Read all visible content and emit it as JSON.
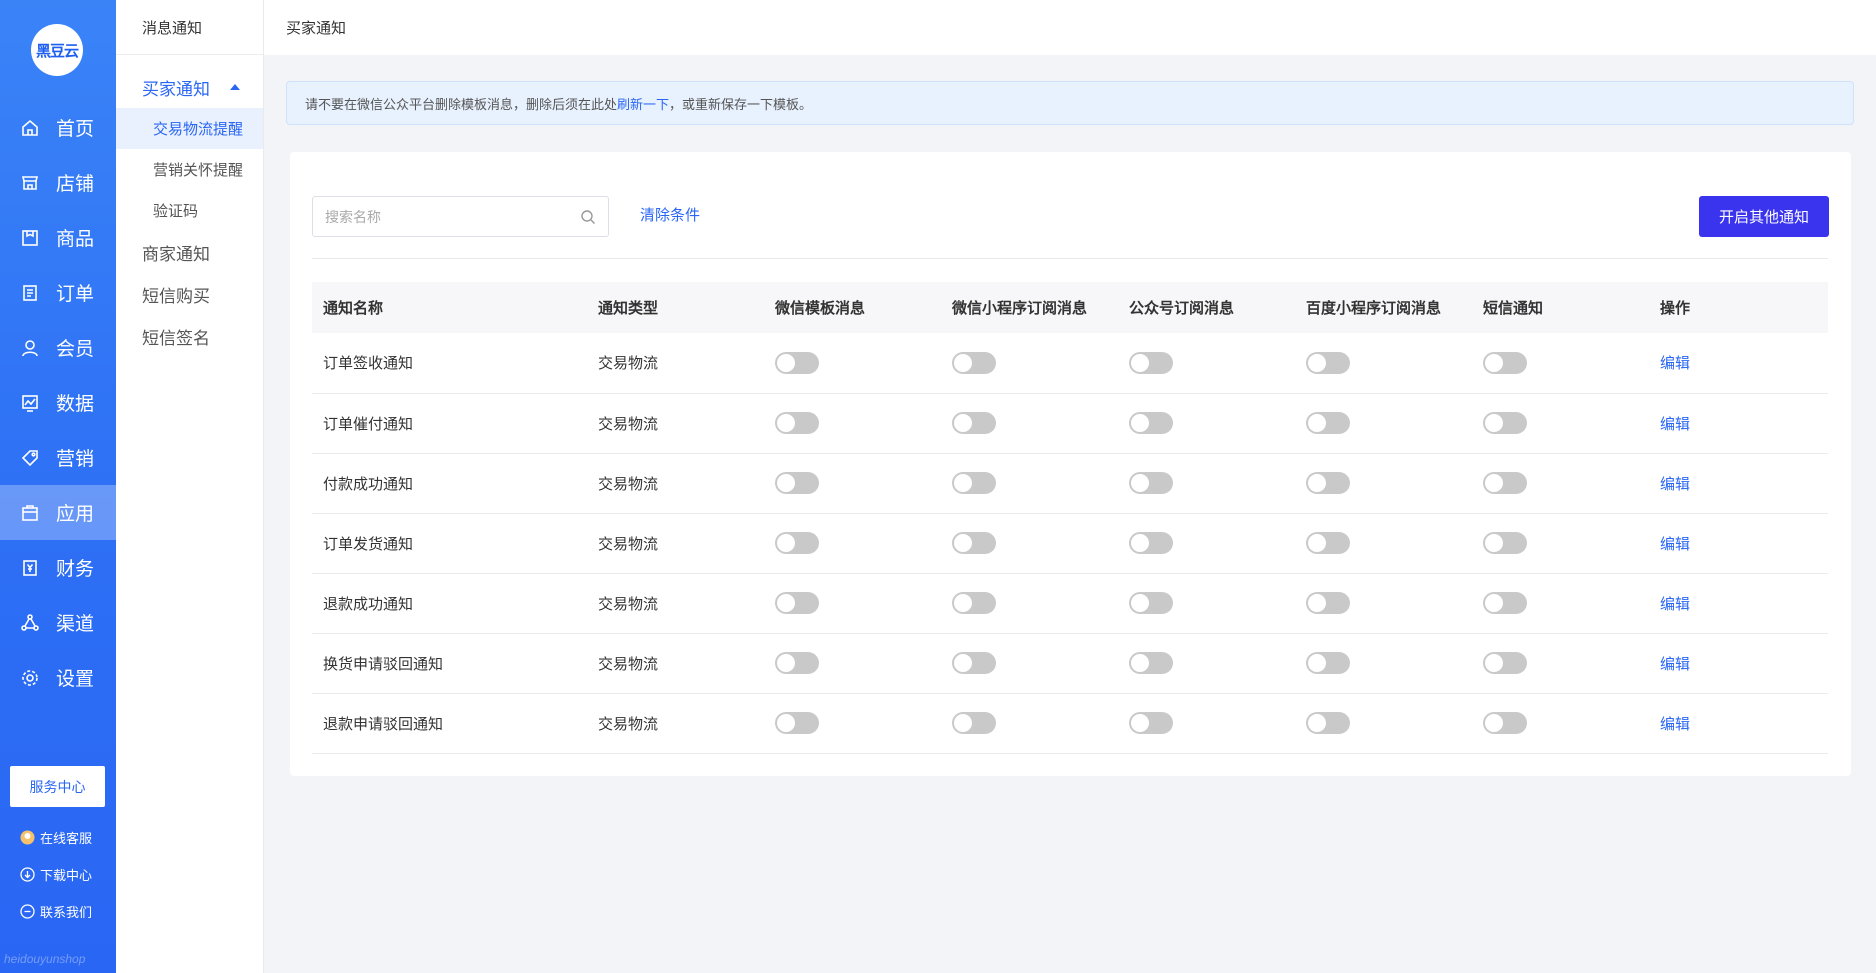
{
  "logo_text": "黑豆云",
  "nav": [
    {
      "label": "首页",
      "icon": "home-icon"
    },
    {
      "label": "店铺",
      "icon": "store-icon"
    },
    {
      "label": "商品",
      "icon": "goods-icon"
    },
    {
      "label": "订单",
      "icon": "order-icon"
    },
    {
      "label": "会员",
      "icon": "member-icon"
    },
    {
      "label": "数据",
      "icon": "chart-icon"
    },
    {
      "label": "营销",
      "icon": "tag-icon"
    },
    {
      "label": "应用",
      "icon": "app-icon",
      "active": true
    },
    {
      "label": "财务",
      "icon": "finance-icon"
    },
    {
      "label": "渠道",
      "icon": "channel-icon"
    },
    {
      "label": "设置",
      "icon": "gear-icon"
    }
  ],
  "service_center": "服务中心",
  "side_links": {
    "online_service": "在线客服",
    "download_center": "下载中心",
    "contact_us": "联系我们"
  },
  "watermark": "heidouyunshop",
  "submenu": {
    "header": "消息通知",
    "buyer_group": "买家通知",
    "buyer_items": [
      "交易物流提醒",
      "营销关怀提醒",
      "验证码"
    ],
    "merchant": "商家通知",
    "sms_buy": "短信购买",
    "sms_sign": "短信签名"
  },
  "topbar_title": "买家通知",
  "notice": {
    "prefix": "请不要在微信公众平台删除模板消息，删除后须在此处 ",
    "link": "刷新一下",
    "suffix": "，或重新保存一下模板。"
  },
  "search": {
    "placeholder": "搜索名称"
  },
  "clear_label": "清除条件",
  "enable_other_label": "开启其他通知",
  "table": {
    "headers": [
      "通知名称",
      "通知类型",
      "微信模板消息",
      "微信小程序订阅消息",
      "公众号订阅消息",
      "百度小程序订阅消息",
      "短信通知",
      "操作"
    ],
    "rows": [
      {
        "name": "订单签收通知",
        "type": "交易物流"
      },
      {
        "name": "订单催付通知",
        "type": "交易物流"
      },
      {
        "name": "付款成功通知",
        "type": "交易物流"
      },
      {
        "name": "订单发货通知",
        "type": "交易物流"
      },
      {
        "name": "退款成功通知",
        "type": "交易物流"
      },
      {
        "name": "换货申请驳回通知",
        "type": "交易物流"
      },
      {
        "name": "退款申请驳回通知",
        "type": "交易物流"
      }
    ],
    "edit_label": "编辑"
  },
  "colors": {
    "primary": "#2a66f4",
    "button": "#3b34ef",
    "toggle_off": "#c9c9c9"
  }
}
